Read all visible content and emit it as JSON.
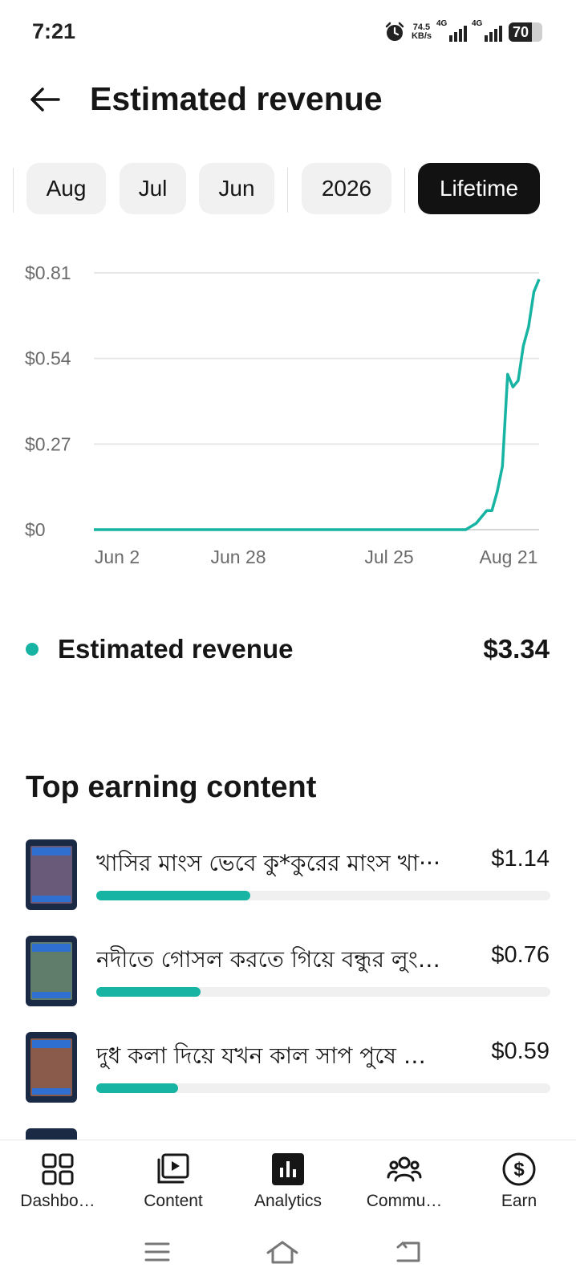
{
  "status_bar": {
    "time": "7:21",
    "net_speed_value": "74.5",
    "net_speed_unit": "KB/s",
    "network_label_1": "4G",
    "network_label_2": "4G",
    "battery_level": "70",
    "icons": [
      "alarm-icon",
      "signal-icon",
      "battery-icon"
    ]
  },
  "header": {
    "title": "Estimated revenue",
    "back_icon": "arrow-left-icon"
  },
  "period_tabs": [
    {
      "label": "Aug",
      "active": false
    },
    {
      "label": "Jul",
      "active": false
    },
    {
      "label": "Jun",
      "active": false
    },
    {
      "label": "2026",
      "active": false
    },
    {
      "label": "Lifetime",
      "active": true
    }
  ],
  "chart_data": {
    "type": "line",
    "title": "",
    "xlabel": "",
    "ylabel": "",
    "y_ticks": [
      "$0",
      "$0.27",
      "$0.54",
      "$0.81"
    ],
    "x_ticks": [
      "Jun 2",
      "Jun 28",
      "Jul 25",
      "Aug 21"
    ],
    "ylim": [
      0,
      0.81
    ],
    "grid": true,
    "series": [
      {
        "color": "#17b3a3",
        "x": [
          "Jun 2",
          "Jun 28",
          "Jul 25",
          "Aug 12",
          "Aug 14",
          "Aug 16",
          "Aug 17",
          "Aug 18",
          "Aug 19",
          "Aug 20",
          "Aug 21",
          "Aug 22",
          "Aug 23",
          "Aug 24",
          "Aug 25",
          "Aug 26"
        ],
        "values": [
          0,
          0,
          0,
          0,
          0.02,
          0.06,
          0.06,
          0.12,
          0.2,
          0.49,
          0.45,
          0.47,
          0.58,
          0.64,
          0.75,
          0.79
        ]
      }
    ]
  },
  "summary": {
    "label": "Estimated revenue",
    "value": "$3.34",
    "dot_color": "#17b3a3"
  },
  "top_earning": {
    "title": "Top earning content",
    "items": [
      {
        "title": "খাসির মাংস ভেবে কু*কুরের মাংস খা···",
        "value": "$1.14",
        "share": 0.34
      },
      {
        "title": "নদীতে গোসল করতে গিয়ে বন্ধুর লুংগি ···",
        "value": "$0.76",
        "share": 0.23
      },
      {
        "title": "দুধ কলা দিয়ে যখন কাল সাপ পুষে আ···",
        "value": "$0.59",
        "share": 0.18
      }
    ]
  },
  "bottom_nav": [
    {
      "label": "Dashbo…",
      "icon": "dashboard-icon",
      "active": false
    },
    {
      "label": "Content",
      "icon": "content-icon",
      "active": false
    },
    {
      "label": "Analytics",
      "icon": "analytics-icon",
      "active": true
    },
    {
      "label": "Commu…",
      "icon": "community-icon",
      "active": false
    },
    {
      "label": "Earn",
      "icon": "earn-icon",
      "active": false
    }
  ],
  "system_nav": {
    "icons": [
      "menu-icon",
      "home-icon",
      "back-icon"
    ]
  }
}
